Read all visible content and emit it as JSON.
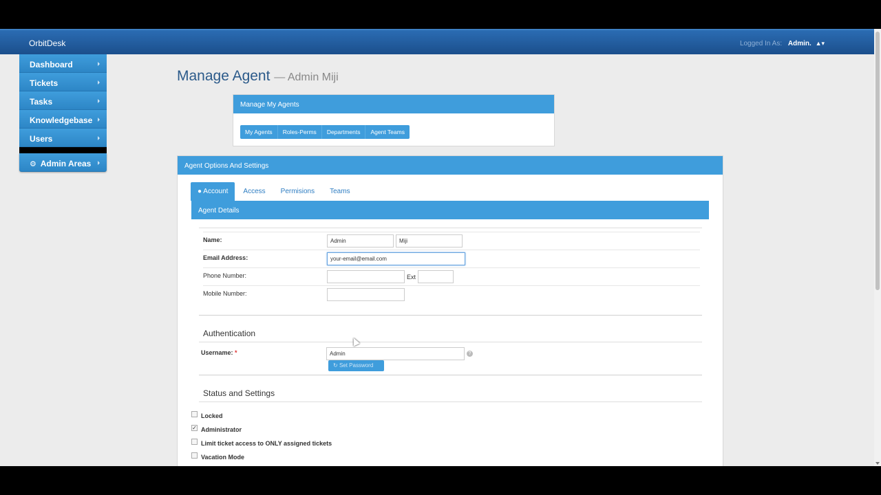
{
  "navbar": {
    "brand": "OrbitDesk",
    "logged_in_as_label": "Logged In As:",
    "user_name": "Admin.",
    "user_icon": "user-icon"
  },
  "sidebar": {
    "items": [
      {
        "label": "Dashboard"
      },
      {
        "label": "Tickets"
      },
      {
        "label": "Tasks"
      },
      {
        "label": "Knowledgebase"
      },
      {
        "label": "Users"
      }
    ],
    "admin_item": {
      "label": "Admin Areas",
      "icon": "gears-icon"
    }
  },
  "page": {
    "title": "Manage Agent",
    "subtitle": "— Admin Miji"
  },
  "manage_panel": {
    "title": "Manage My Agents",
    "buttons": [
      "My Agents",
      "Roles-Perms",
      "Departments",
      "Agent Teams"
    ]
  },
  "options_panel": {
    "title": "Agent Options And Settings",
    "tabs": [
      "Account",
      "Access",
      "Permisions",
      "Teams"
    ],
    "details_title": "Agent Details"
  },
  "form": {
    "name_label": "Name:",
    "first_name": "Admin",
    "last_name": "Miji",
    "email_label": "Email Address:",
    "email": "your-email@email.com",
    "phone_label": "Phone Number:",
    "phone": "",
    "ext_label": "Ext",
    "ext": "",
    "mobile_label": "Mobile Number:",
    "mobile": ""
  },
  "auth": {
    "title": "Authentication",
    "username_label": "Username:",
    "required_mark": "*",
    "username": "Admin",
    "help_glyph": "?",
    "set_password_label": "Set Password"
  },
  "status": {
    "title": "Status and Settings",
    "checkboxes": [
      {
        "label": "Locked",
        "checked": false
      },
      {
        "label": "Administrator",
        "checked": true
      },
      {
        "label": "Limit ticket access to ONLY assigned tickets",
        "checked": false
      },
      {
        "label": "Vacation Mode",
        "checked": false
      }
    ]
  },
  "colors": {
    "accent": "#3f9ddc",
    "navbar": "#1b4f8c"
  }
}
